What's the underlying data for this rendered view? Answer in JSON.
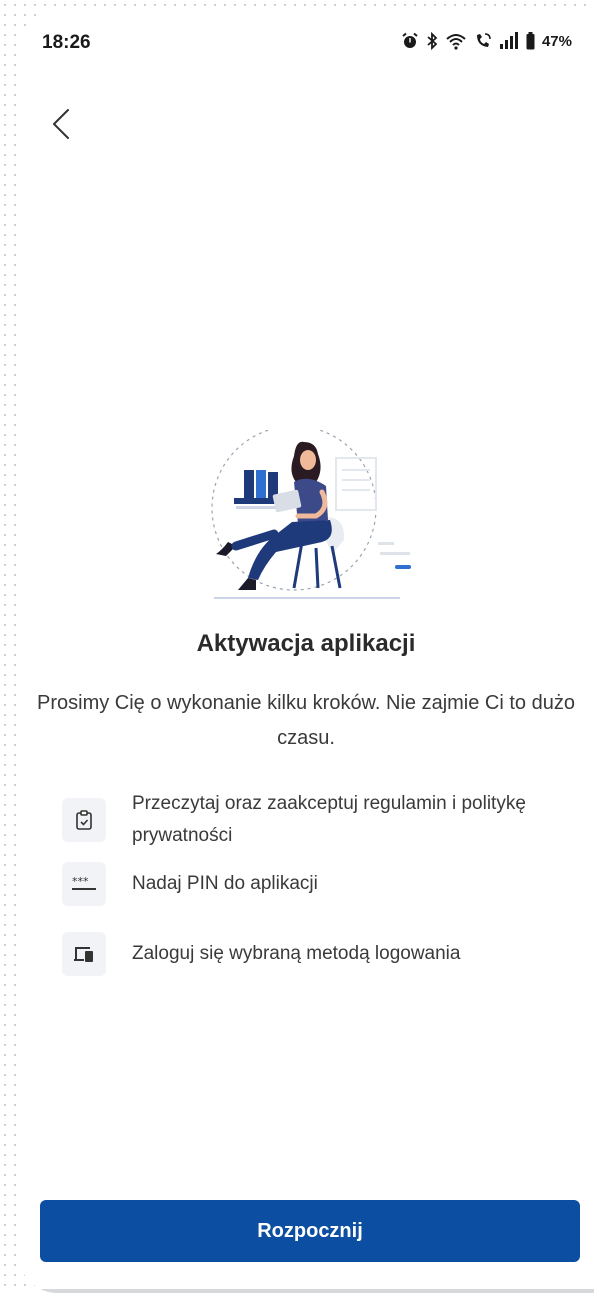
{
  "status_bar": {
    "time": "18:26",
    "battery": "47%",
    "icons": [
      "alarm-icon",
      "bluetooth-icon",
      "wifi-icon",
      "wifi-calling-icon",
      "signal-icon",
      "battery-icon"
    ]
  },
  "nav": {
    "back_icon": "chevron-left-icon"
  },
  "content": {
    "title": "Aktywacja aplikacji",
    "intro": "Prosimy Cię o wykonanie kilku kroków. Nie zajmie Ci to dużo czasu.",
    "steps": [
      {
        "icon": "clipboard-check-icon",
        "text": "Przeczytaj oraz zaakceptuj regulamin i politykę prywatności"
      },
      {
        "icon": "pin-asterisks-icon",
        "text": "Nadaj PIN do aplikacji"
      },
      {
        "icon": "devices-icon",
        "text": "Zaloguj się wybraną metodą logowania"
      }
    ]
  },
  "footer": {
    "start_label": "Rozpocznij"
  },
  "colors": {
    "primary": "#0b4ea2",
    "illustration_accent": "#2f6fd0",
    "text": "#3a3a3a"
  }
}
